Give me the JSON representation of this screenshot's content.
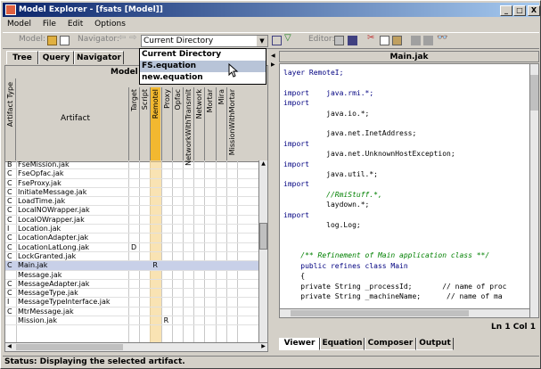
{
  "window": {
    "title": "Model Explorer - [fsats [Model]]",
    "buttons": [
      "_",
      "□",
      "X"
    ]
  },
  "menu": [
    "Model",
    "File",
    "Edit",
    "Options"
  ],
  "toolbar": {
    "model_label": "Model:",
    "navigator_label": "Navigator:",
    "editor_label": "Editor:",
    "combo_value": "Current Directory"
  },
  "dropdown": {
    "options": [
      "Current Directory",
      "FS.equation",
      "new.equation"
    ],
    "selected": 1
  },
  "left_tabs": [
    "Tree",
    "Query",
    "Navigator"
  ],
  "grid": {
    "group_header": "Model Na",
    "col_type": "Artifact Type",
    "col_artifact": "Artifact",
    "columns": [
      "Target",
      "Script",
      "RemoteI",
      "Proxy",
      "Opfac",
      "NetworkWithTransmit",
      "Network",
      "Mortar",
      "Mira",
      "MissionWithMortar"
    ],
    "highlight_col": 2,
    "rows": [
      {
        "t": "B",
        "n": "FseMission.jak",
        "c": {}
      },
      {
        "t": "C",
        "n": "FseOpfac.jak",
        "c": {}
      },
      {
        "t": "C",
        "n": "FseProxy.jak",
        "c": {}
      },
      {
        "t": "C",
        "n": "InitiateMessage.jak",
        "c": {}
      },
      {
        "t": "C",
        "n": "LoadTime.jak",
        "c": {}
      },
      {
        "t": "C",
        "n": "LocalNOWrapper.jak",
        "c": {}
      },
      {
        "t": "C",
        "n": "LocalOWrapper.jak",
        "c": {}
      },
      {
        "t": "I",
        "n": "Location.jak",
        "c": {}
      },
      {
        "t": "C",
        "n": "LocationAdapter.jak",
        "c": {}
      },
      {
        "t": "C",
        "n": "LocationLatLong.jak",
        "c": {
          "0": "D"
        }
      },
      {
        "t": "C",
        "n": "LockGranted.jak",
        "c": {}
      },
      {
        "t": "C",
        "n": "Main.jak",
        "c": {
          "2": "R"
        },
        "hl": true
      },
      {
        "t": "",
        "n": "Message.jak",
        "c": {}
      },
      {
        "t": "C",
        "n": "MessageAdapter.jak",
        "c": {}
      },
      {
        "t": "C",
        "n": "MessageType.jak",
        "c": {}
      },
      {
        "t": "I",
        "n": "MessageTypeInterface.jak",
        "c": {}
      },
      {
        "t": "C",
        "n": "MtrMessage.jak",
        "c": {}
      },
      {
        "t": "",
        "n": "Mission.jak",
        "c": {
          "3": "R"
        }
      }
    ]
  },
  "editor": {
    "title": "Main.jak",
    "position": "Ln 1    Col 1",
    "lines": [
      [
        "kw",
        "layer RemoteI;"
      ],
      [
        "",
        ""
      ],
      [
        "kw",
        "import    java.rmi.*;"
      ],
      [
        "kw",
        "import"
      ],
      [
        "",
        "          java.io.*;"
      ],
      [
        "",
        ""
      ],
      [
        "",
        "          java.net.InetAddress;"
      ],
      [
        "kw",
        "import"
      ],
      [
        "",
        "          java.net.UnknownHostException;"
      ],
      [
        "kw",
        "import"
      ],
      [
        "",
        "          java.util.*;"
      ],
      [
        "kw",
        "import"
      ],
      [
        "cm",
        "          //RmiStuff.*,"
      ],
      [
        "",
        "          laydown.*;"
      ],
      [
        "kw",
        "import"
      ],
      [
        "",
        "          log.Log;"
      ],
      [
        "",
        ""
      ],
      [
        "",
        ""
      ],
      [
        "cm",
        "    /** Refinement of Main application class **/"
      ],
      [
        "kw",
        "    public refines class Main"
      ],
      [
        "",
        "    {"
      ],
      [
        "",
        "    private String _processId;       // name of proc"
      ],
      [
        "",
        "    private String _machineName;      // name of ma"
      ]
    ],
    "tabs": [
      "Viewer",
      "Equation",
      "Composer",
      "Output"
    ]
  },
  "status": "Status: Displaying the selected artifact."
}
